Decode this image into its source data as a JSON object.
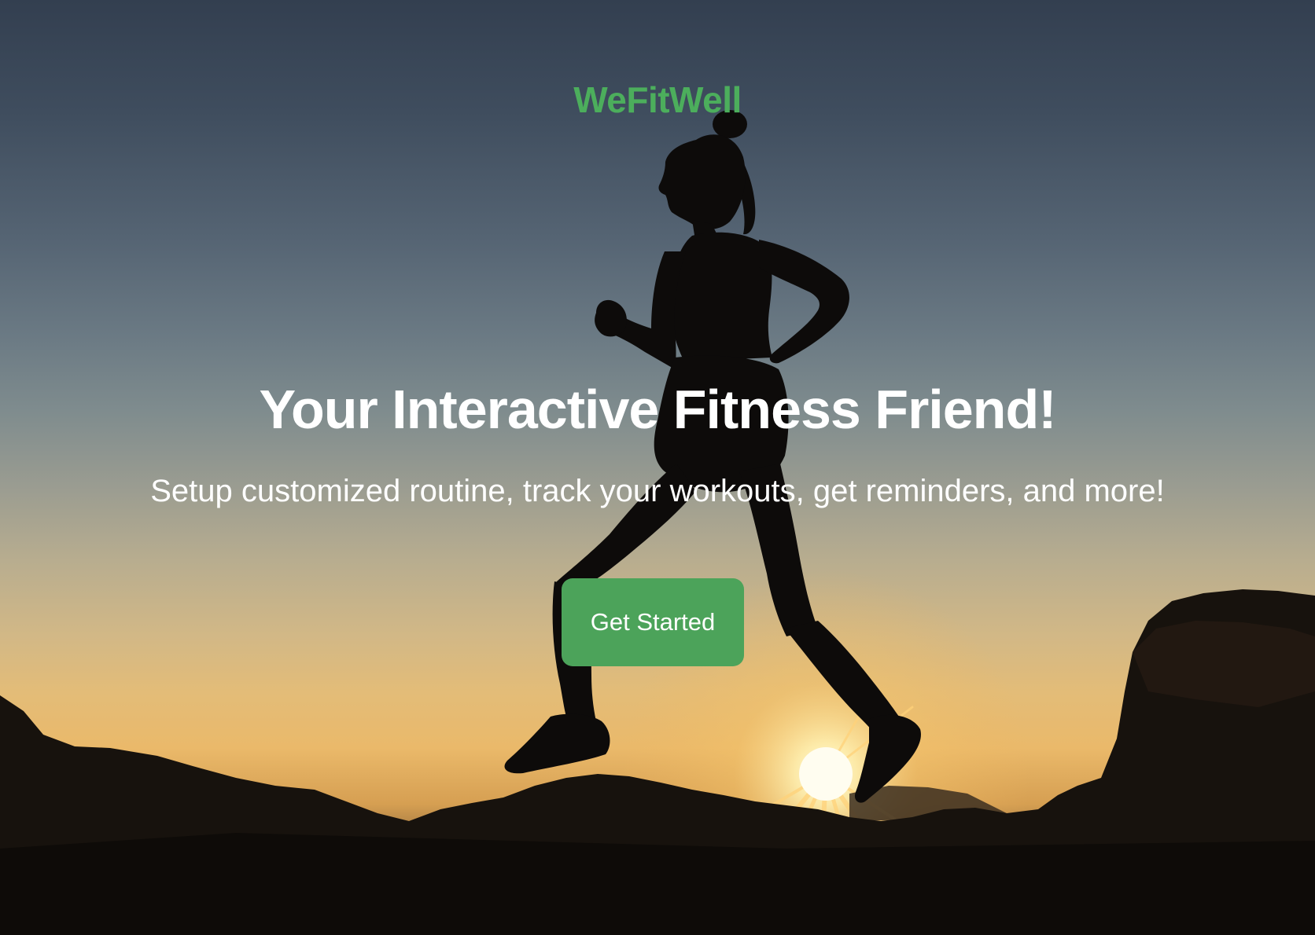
{
  "brand": {
    "name": "WeFitWell",
    "color": "#4cae5c"
  },
  "hero": {
    "headline": "Your Interactive Fitness Friend!",
    "subheadline": "Setup customized routine, track your workouts, get reminders, and more!",
    "cta_label": "Get Started",
    "cta_color": "#4ca35a",
    "background_image": "silhouette of a woman running on rocks at sunset"
  }
}
